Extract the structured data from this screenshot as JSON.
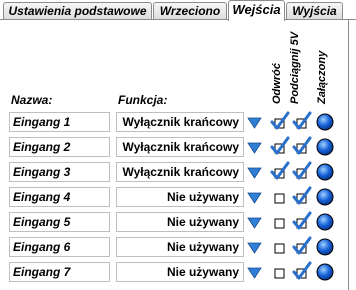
{
  "tabs": [
    {
      "label": "Ustawienia podstawowe",
      "active": false
    },
    {
      "label": "Wrzeciono",
      "active": false
    },
    {
      "label": "Wejścia",
      "active": true
    },
    {
      "label": "Wyjścia",
      "active": false
    }
  ],
  "columns": {
    "name": "Nazwa:",
    "function": "Funkcja:",
    "invert": "Odwróć",
    "pullup": "Podciągnij 5V",
    "connected": "Załączony"
  },
  "inputs": [
    {
      "name": "Eingang 1",
      "function": "Wyłącznik krańcowy",
      "invert": true,
      "pullup": true,
      "connected": true
    },
    {
      "name": "Eingang 2",
      "function": "Wyłącznik krańcowy",
      "invert": true,
      "pullup": true,
      "connected": true
    },
    {
      "name": "Eingang 3",
      "function": "Wyłącznik krańcowy",
      "invert": true,
      "pullup": true,
      "connected": true
    },
    {
      "name": "Eingang 4",
      "function": "Nie używany",
      "invert": false,
      "pullup": true,
      "connected": true
    },
    {
      "name": "Eingang 5",
      "function": "Nie używany",
      "invert": false,
      "pullup": true,
      "connected": true
    },
    {
      "name": "Eingang 6",
      "function": "Nie używany",
      "invert": false,
      "pullup": true,
      "connected": true
    },
    {
      "name": "Eingang 7",
      "function": "Nie używany",
      "invert": false,
      "pullup": true,
      "connected": true
    }
  ],
  "colors": {
    "check": "#2a6fc9",
    "arrow": "#2f7fd6",
    "led": "#1560d8"
  },
  "icons": {
    "dropdown": "triangle-down-icon",
    "checkbox": "checkbox-icon",
    "led": "blue-led-icon"
  }
}
